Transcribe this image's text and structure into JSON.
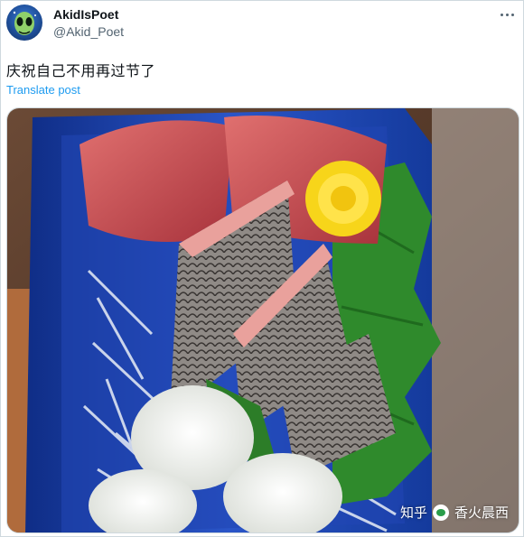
{
  "tweet": {
    "author_name": "AkidIsPoet",
    "author_handle": "@Akid_Poet",
    "text": "庆祝自己不用再过节了",
    "translate_label": "Translate post"
  },
  "media": {
    "description_icon": "sashimi-platter-photo"
  },
  "watermark": {
    "site": "知乎",
    "author": "香火晨西"
  },
  "colors": {
    "link": "#1d9bf0",
    "secondary_text": "#536471",
    "border": "#cfd9de",
    "tray_blue": "#1a3fa0"
  }
}
